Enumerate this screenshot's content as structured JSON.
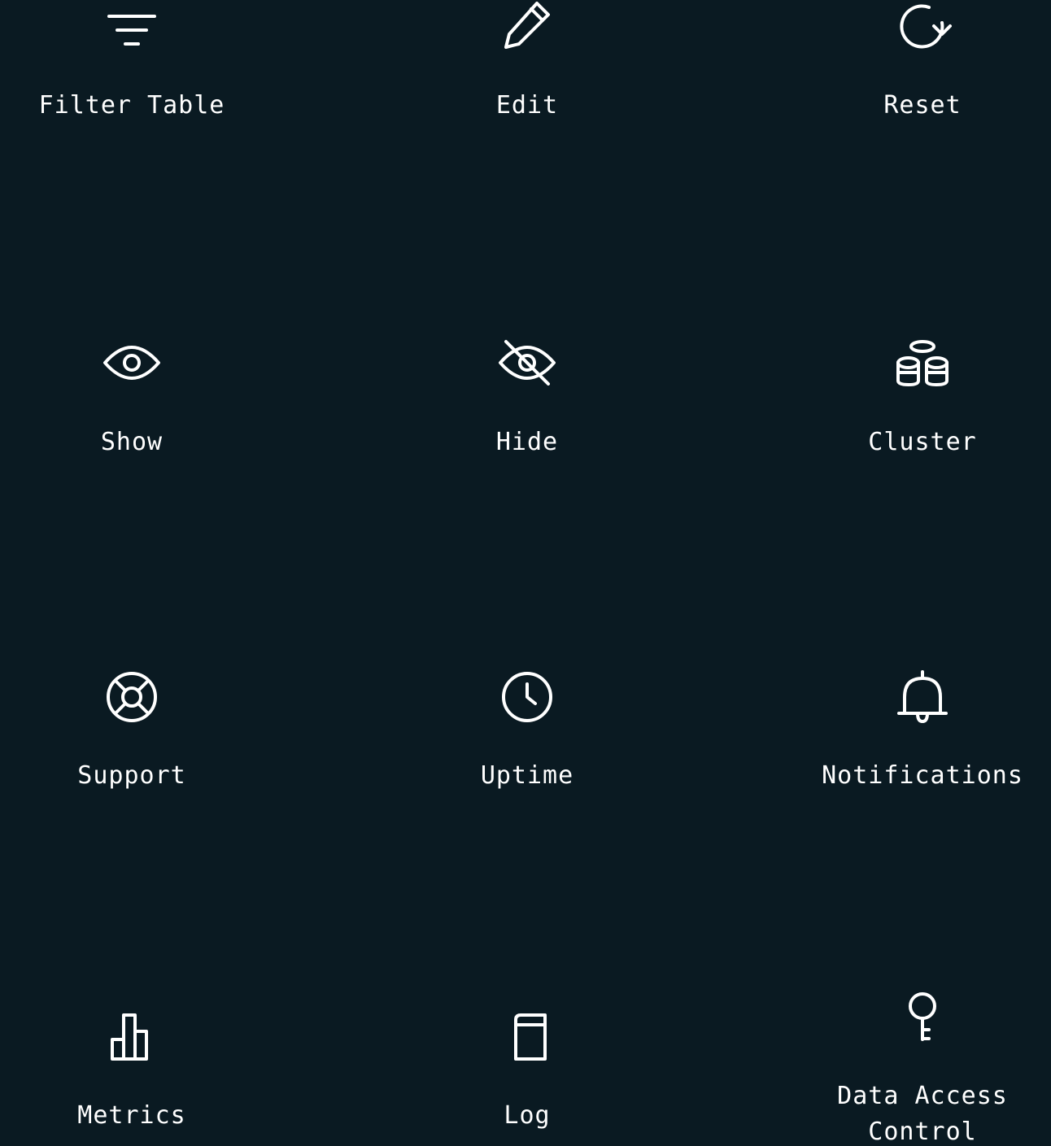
{
  "colors": {
    "background": "#0a1a22",
    "foreground": "#ffffff"
  },
  "tiles": [
    {
      "label": "Filter Table",
      "icon": "filter-icon"
    },
    {
      "label": "Edit",
      "icon": "pencil-icon"
    },
    {
      "label": "Reset",
      "icon": "reset-icon"
    },
    {
      "label": "Show",
      "icon": "eye-icon"
    },
    {
      "label": "Hide",
      "icon": "eye-off-icon"
    },
    {
      "label": "Cluster",
      "icon": "cluster-icon"
    },
    {
      "label": "Support",
      "icon": "lifebuoy-icon"
    },
    {
      "label": "Uptime",
      "icon": "clock-icon"
    },
    {
      "label": "Notifications",
      "icon": "bell-icon"
    },
    {
      "label": "Metrics",
      "icon": "bar-chart-icon"
    },
    {
      "label": "Log",
      "icon": "log-icon"
    },
    {
      "label": "Data Access\nControl",
      "icon": "key-icon"
    }
  ]
}
